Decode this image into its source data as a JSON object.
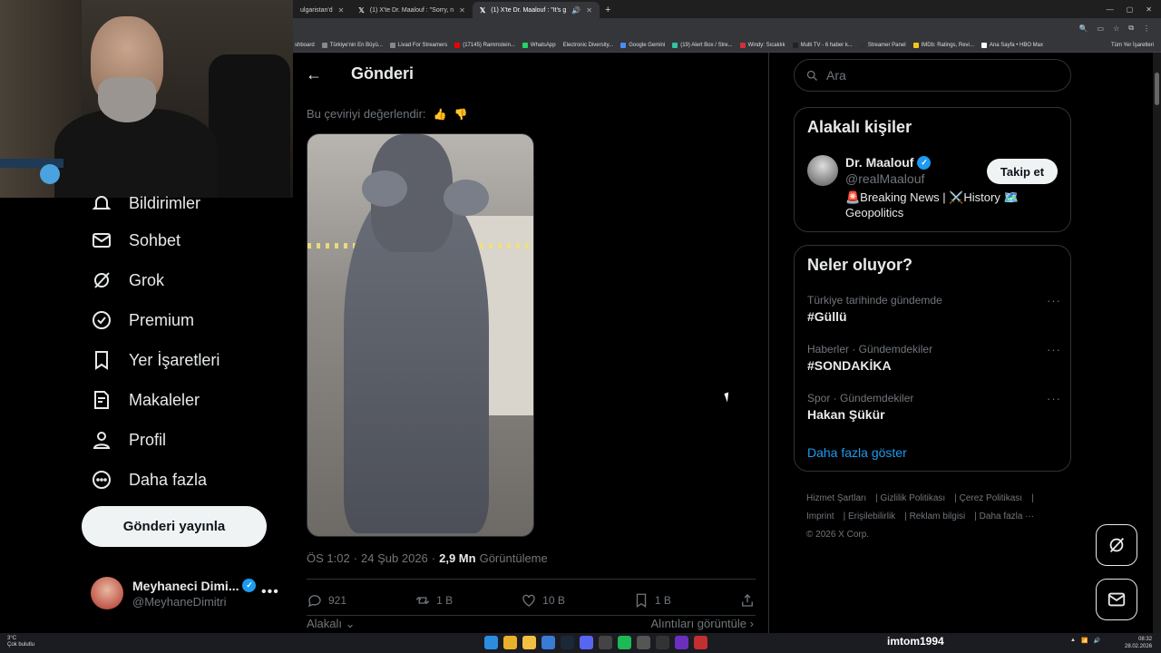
{
  "browser": {
    "tabs": [
      {
        "label": "ulgaristan'd",
        "active": false
      },
      {
        "label": "(1) X'te Dr. Maalouf : \"Sorry, n",
        "active": false
      },
      {
        "label": "(1) X'te Dr. Maalouf : \"It's g",
        "active": true
      }
    ],
    "bookmarks": [
      "shboard",
      "Türkiye'nin En Büyü...",
      "Livad For Streamers",
      "(17145) Rammstein...",
      "WhatsApp",
      "Electronic Diversity...",
      "Google Gemini",
      "(19) Alert Box / Stre...",
      "Windy: Sıcaklık",
      "Multi TV - 6 haber k...",
      "Streamer Panel",
      "IMDb: Ratings, Revi...",
      "Ana Sayfa • HBO Max"
    ],
    "all_bookmarks": "Tüm Yer İşaretleri"
  },
  "nav": {
    "items": [
      {
        "label": "Bildirimler",
        "icon": "bell-icon"
      },
      {
        "label": "Sohbet",
        "icon": "mail-icon"
      },
      {
        "label": "Grok",
        "icon": "grok-icon"
      },
      {
        "label": "Premium",
        "icon": "premium-icon"
      },
      {
        "label": "Yer İşaretleri",
        "icon": "bookmark-icon"
      },
      {
        "label": "Makaleler",
        "icon": "article-icon"
      },
      {
        "label": "Profil",
        "icon": "profile-icon"
      },
      {
        "label": "Daha fazla",
        "icon": "more-circle-icon"
      }
    ],
    "post_button": "Gönderi yayınla",
    "account": {
      "name": "Meyhaneci Dimi...",
      "handle": "@MeyhaneDimitri"
    }
  },
  "post": {
    "title": "Gönderi",
    "rate_translation": "Bu çeviriyi değerlendir:",
    "time": "ÖS 1:02",
    "date": "24 Şub 2026",
    "views_count": "2,9 Mn",
    "views_label": "Görüntüleme",
    "replies": "921",
    "reposts": "1 B",
    "likes": "10 B",
    "bookmarks": "1 B",
    "related": "Alakalı",
    "quotes_link": "Alıntıları görüntüle"
  },
  "sidebar": {
    "search_placeholder": "Ara",
    "related_people_title": "Alakalı kişiler",
    "person": {
      "name": "Dr. Maalouf",
      "handle": "@realMaalouf",
      "bio": "🚨Breaking News | ⚔️History 🗺️ Geopolitics",
      "follow": "Takip et"
    },
    "whats_happening_title": "Neler oluyor?",
    "trends": [
      {
        "meta": "Türkiye tarihinde gündemde",
        "name": "#Güllü"
      },
      {
        "meta": "Haberler · Gündemdekiler",
        "name": "#SONDAKİKA"
      },
      {
        "meta": "Spor · Gündemdekiler",
        "name": "Hakan Şükür"
      }
    ],
    "show_more": "Daha fazla göster",
    "footer": [
      "Hizmet Şartları",
      "Gizlilik Politikası",
      "Çerez Politikası",
      "Imprint",
      "Erişilebilirlik",
      "Reklam bilgisi",
      "Daha fazla ···",
      "© 2026 X Corp."
    ]
  },
  "taskbar": {
    "weather_temp": "3°C",
    "weather_desc": "Çok bulutlu",
    "stream_user": "imtom1994",
    "time": "08:32",
    "date": "28.02.2026"
  }
}
